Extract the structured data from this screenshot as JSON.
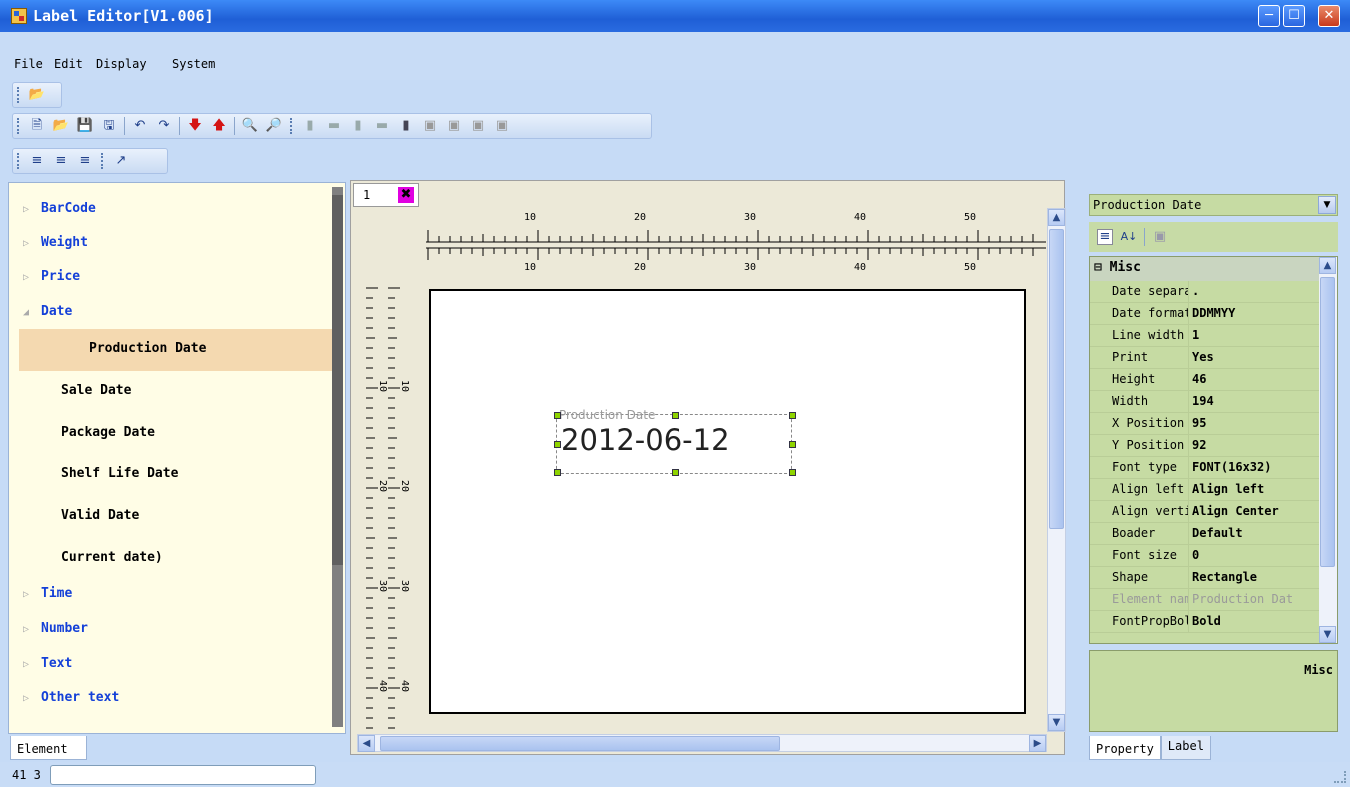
{
  "window": {
    "title": "Label Editor[V1.006]"
  },
  "menu": [
    "File",
    "Edit",
    "Display",
    "System"
  ],
  "toolbars": {
    "tb1": [
      "open-icon"
    ],
    "tb2": [
      "new-icon",
      "open-icon",
      "save-icon",
      "save-as-icon",
      "undo-icon",
      "redo-icon",
      "move-down-icon",
      "move-up-icon",
      "zoom-in-icon",
      "zoom-out-icon"
    ],
    "tb3": [
      "align-left-edge-icon",
      "align-top-edge-icon",
      "align-right-edge-icon",
      "align-bottom-edge-icon",
      "same-size-icon",
      "image1-icon",
      "image2-icon",
      "image3-icon",
      "image4-icon"
    ],
    "tb4": [
      "text-left-icon",
      "text-center-icon",
      "text-right-icon",
      "pointer-icon"
    ]
  },
  "element_tree": {
    "categories": [
      {
        "label": "BarCode",
        "expanded": false
      },
      {
        "label": "Weight",
        "expanded": false
      },
      {
        "label": "Price",
        "expanded": false
      },
      {
        "label": "Date",
        "expanded": true
      },
      {
        "label": "Time",
        "expanded": false
      },
      {
        "label": "Number",
        "expanded": false
      },
      {
        "label": "Text",
        "expanded": false
      },
      {
        "label": "Other text",
        "expanded": false
      }
    ],
    "date_items": [
      "Production Date",
      "Sale Date",
      "Package Date",
      "Shelf Life Date",
      "Valid Date",
      "Current date)"
    ],
    "selected": "Production Date",
    "tab": "Element"
  },
  "designer": {
    "page_tab": "1",
    "ruler_labels": [
      "10",
      "20",
      "30",
      "40",
      "50"
    ],
    "vruler_labels": [
      "10",
      "20",
      "30",
      "40"
    ],
    "element": {
      "caption": "Production Date",
      "value": "2012-06-12"
    }
  },
  "properties": {
    "selected_object": "Production Date",
    "category": "Misc",
    "rows": [
      {
        "key": "Date separa",
        "value": "."
      },
      {
        "key": "Date format",
        "value": "DDMMYY"
      },
      {
        "key": "Line width",
        "value": "1"
      },
      {
        "key": "Print",
        "value": "Yes"
      },
      {
        "key": "Height",
        "value": "46"
      },
      {
        "key": "Width",
        "value": "194"
      },
      {
        "key": "X Position",
        "value": "95"
      },
      {
        "key": "Y Position",
        "value": "92"
      },
      {
        "key": "Font type",
        "value": "FONT(16x32)"
      },
      {
        "key": "Align left",
        "value": "Align left"
      },
      {
        "key": "Align verti",
        "value": "Align Center"
      },
      {
        "key": "Boader",
        "value": "Default"
      },
      {
        "key": "Font size",
        "value": "0"
      },
      {
        "key": "Shape",
        "value": "Rectangle"
      },
      {
        "key": "Element nam",
        "value": "Production Dat",
        "disabled": true
      },
      {
        "key": "FontPropBol",
        "value": "Bold"
      }
    ],
    "description": "Misc",
    "tabs": [
      "Property",
      "Label"
    ]
  },
  "status": {
    "coords": "41 3",
    "text": ""
  },
  "colors": {
    "titlebar": "#2a6be0",
    "selection": "#f4d9b0",
    "property_bg": "#c6dba3",
    "tree_bg": "#fffde6",
    "category_text": "#1440d8"
  }
}
